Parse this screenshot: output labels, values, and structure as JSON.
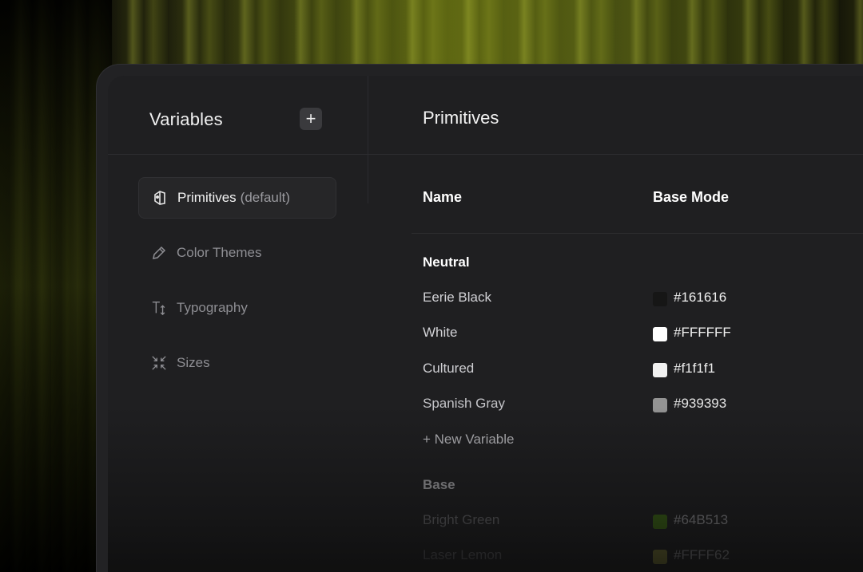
{
  "sidebar": {
    "title": "Variables",
    "add_label": "+",
    "items": [
      {
        "label": "Primitives",
        "suffix": "(default)",
        "icon": "tag-icon",
        "active": true
      },
      {
        "label": "Color Themes",
        "icon": "pencil-icon",
        "active": false
      },
      {
        "label": "Typography",
        "icon": "text-size-icon",
        "active": false
      },
      {
        "label": "Sizes",
        "icon": "shrink-arrows-icon",
        "active": false
      }
    ]
  },
  "main": {
    "title": "Primitives",
    "columns": {
      "name": "Name",
      "mode": "Base Mode"
    },
    "groups": [
      {
        "title": "Neutral",
        "rows": [
          {
            "name": "Eerie Black",
            "value": "#161616",
            "color": "#161616"
          },
          {
            "name": "White",
            "value": "#FFFFFF",
            "color": "#FFFFFF"
          },
          {
            "name": "Cultured",
            "value": "#f1f1f1",
            "color": "#f1f1f1"
          },
          {
            "name": "Spanish Gray",
            "value": "#939393",
            "color": "#939393"
          }
        ],
        "new_variable": "+ New Variable"
      },
      {
        "title": "Base",
        "rows": [
          {
            "name": "Bright Green",
            "value": "#64B513",
            "color": "#64B513"
          },
          {
            "name": "Laser Lemon",
            "value": "#FFFF62",
            "color": "#FFFF62"
          }
        ]
      }
    ]
  }
}
